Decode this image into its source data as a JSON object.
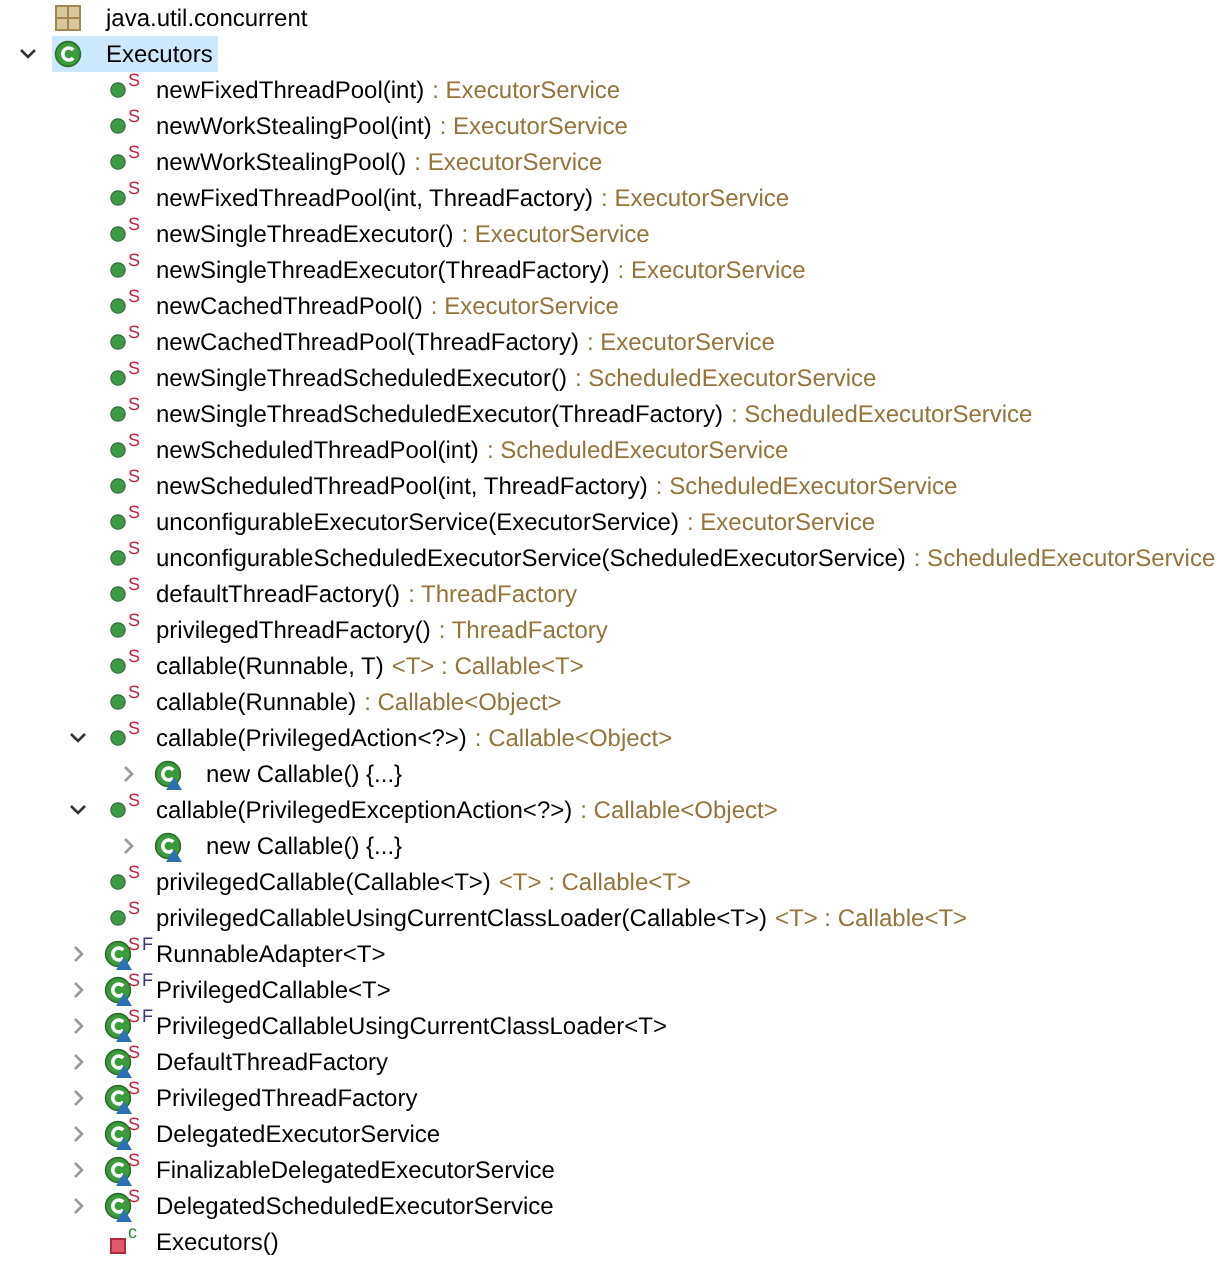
{
  "outline": [
    {
      "kind": "package",
      "name": "java.util.concurrent",
      "selected": false
    },
    {
      "kind": "class",
      "name": "Executors",
      "selected": true,
      "expanded": true,
      "children": [
        {
          "kind": "method",
          "name": "newFixedThreadPool(int)",
          "detail": ": ExecutorService",
          "modifiers": [
            {
              "label": "S",
              "kind": "static"
            }
          ],
          "selected": false
        },
        {
          "kind": "method",
          "name": "newWorkStealingPool(int)",
          "detail": ": ExecutorService",
          "modifiers": [
            {
              "label": "S",
              "kind": "static"
            }
          ],
          "selected": false
        },
        {
          "kind": "method",
          "name": "newWorkStealingPool()",
          "detail": ": ExecutorService",
          "modifiers": [
            {
              "label": "S",
              "kind": "static"
            }
          ],
          "selected": false
        },
        {
          "kind": "method",
          "name": "newFixedThreadPool(int, ThreadFactory)",
          "detail": ": ExecutorService",
          "modifiers": [
            {
              "label": "S",
              "kind": "static"
            }
          ],
          "selected": false
        },
        {
          "kind": "method",
          "name": "newSingleThreadExecutor()",
          "detail": ": ExecutorService",
          "modifiers": [
            {
              "label": "S",
              "kind": "static"
            }
          ],
          "selected": false
        },
        {
          "kind": "method",
          "name": "newSingleThreadExecutor(ThreadFactory)",
          "detail": ": ExecutorService",
          "modifiers": [
            {
              "label": "S",
              "kind": "static"
            }
          ],
          "selected": false
        },
        {
          "kind": "method",
          "name": "newCachedThreadPool()",
          "detail": ": ExecutorService",
          "modifiers": [
            {
              "label": "S",
              "kind": "static"
            }
          ],
          "selected": false
        },
        {
          "kind": "method",
          "name": "newCachedThreadPool(ThreadFactory)",
          "detail": ": ExecutorService",
          "modifiers": [
            {
              "label": "S",
              "kind": "static"
            }
          ],
          "selected": false
        },
        {
          "kind": "method",
          "name": "newSingleThreadScheduledExecutor()",
          "detail": ": ScheduledExecutorService",
          "modifiers": [
            {
              "label": "S",
              "kind": "static"
            }
          ],
          "selected": false
        },
        {
          "kind": "method",
          "name": "newSingleThreadScheduledExecutor(ThreadFactory)",
          "detail": ": ScheduledExecutorService",
          "modifiers": [
            {
              "label": "S",
              "kind": "static"
            }
          ],
          "selected": false
        },
        {
          "kind": "method",
          "name": "newScheduledThreadPool(int)",
          "detail": ": ScheduledExecutorService",
          "modifiers": [
            {
              "label": "S",
              "kind": "static"
            }
          ],
          "selected": false
        },
        {
          "kind": "method",
          "name": "newScheduledThreadPool(int, ThreadFactory)",
          "detail": ": ScheduledExecutorService",
          "modifiers": [
            {
              "label": "S",
              "kind": "static"
            }
          ],
          "selected": false
        },
        {
          "kind": "method",
          "name": "unconfigurableExecutorService(ExecutorService)",
          "detail": ": ExecutorService",
          "modifiers": [
            {
              "label": "S",
              "kind": "static"
            }
          ],
          "selected": false
        },
        {
          "kind": "method",
          "name": "unconfigurableScheduledExecutorService(ScheduledExecutorService)",
          "detail": ": ScheduledExecutorService",
          "modifiers": [
            {
              "label": "S",
              "kind": "static"
            }
          ],
          "selected": false
        },
        {
          "kind": "method",
          "name": "defaultThreadFactory()",
          "detail": ": ThreadFactory",
          "modifiers": [
            {
              "label": "S",
              "kind": "static"
            }
          ],
          "selected": false
        },
        {
          "kind": "method",
          "name": "privilegedThreadFactory()",
          "detail": ": ThreadFactory",
          "modifiers": [
            {
              "label": "S",
              "kind": "static"
            }
          ],
          "selected": false
        },
        {
          "kind": "method",
          "name": "callable(Runnable, T)",
          "detail": "<T> : Callable<T>",
          "modifiers": [
            {
              "label": "S",
              "kind": "static"
            }
          ],
          "selected": false
        },
        {
          "kind": "method",
          "name": "callable(Runnable)",
          "detail": ": Callable<Object>",
          "modifiers": [
            {
              "label": "S",
              "kind": "static"
            }
          ],
          "selected": false
        },
        {
          "kind": "method",
          "name": "callable(PrivilegedAction<?>)",
          "detail": ": Callable<Object>",
          "modifiers": [
            {
              "label": "S",
              "kind": "static"
            }
          ],
          "selected": false,
          "expanded": true,
          "children": [
            {
              "kind": "anonymous",
              "name": "new Callable() {...}",
              "selected": false,
              "expanded": false
            }
          ]
        },
        {
          "kind": "method",
          "name": "callable(PrivilegedExceptionAction<?>)",
          "detail": ": Callable<Object>",
          "modifiers": [
            {
              "label": "S",
              "kind": "static"
            }
          ],
          "selected": false,
          "expanded": true,
          "children": [
            {
              "kind": "anonymous",
              "name": "new Callable() {...}",
              "selected": false,
              "expanded": false
            }
          ]
        },
        {
          "kind": "method",
          "name": "privilegedCallable(Callable<T>)",
          "detail": "<T> : Callable<T>",
          "modifiers": [
            {
              "label": "S",
              "kind": "static"
            }
          ],
          "selected": false
        },
        {
          "kind": "method",
          "name": "privilegedCallableUsingCurrentClassLoader(Callable<T>)",
          "detail": "<T> : Callable<T>",
          "modifiers": [
            {
              "label": "S",
              "kind": "static"
            }
          ],
          "selected": false
        },
        {
          "kind": "inner-class",
          "name": "RunnableAdapter<T>",
          "modifiers": [
            {
              "label": "S",
              "kind": "static"
            },
            {
              "label": "F",
              "kind": "final"
            }
          ],
          "selected": false,
          "expanded": false
        },
        {
          "kind": "inner-class",
          "name": "PrivilegedCallable<T>",
          "modifiers": [
            {
              "label": "S",
              "kind": "static"
            },
            {
              "label": "F",
              "kind": "final"
            }
          ],
          "selected": false,
          "expanded": false
        },
        {
          "kind": "inner-class",
          "name": "PrivilegedCallableUsingCurrentClassLoader<T>",
          "modifiers": [
            {
              "label": "S",
              "kind": "static"
            },
            {
              "label": "F",
              "kind": "final"
            }
          ],
          "selected": false,
          "expanded": false
        },
        {
          "kind": "inner-class",
          "name": "DefaultThreadFactory",
          "modifiers": [
            {
              "label": "S",
              "kind": "static"
            }
          ],
          "selected": false,
          "expanded": false
        },
        {
          "kind": "inner-class",
          "name": "PrivilegedThreadFactory",
          "modifiers": [
            {
              "label": "S",
              "kind": "static"
            }
          ],
          "selected": false,
          "expanded": false
        },
        {
          "kind": "inner-class",
          "name": "DelegatedExecutorService",
          "modifiers": [
            {
              "label": "S",
              "kind": "static"
            }
          ],
          "selected": false,
          "expanded": false
        },
        {
          "kind": "inner-class",
          "name": "FinalizableDelegatedExecutorService",
          "modifiers": [
            {
              "label": "S",
              "kind": "static"
            }
          ],
          "selected": false,
          "expanded": false
        },
        {
          "kind": "inner-class",
          "name": "DelegatedScheduledExecutorService",
          "modifiers": [
            {
              "label": "S",
              "kind": "static"
            }
          ],
          "selected": false,
          "expanded": false
        },
        {
          "kind": "constructor",
          "name": "Executors()",
          "modifiers": [
            {
              "label": "c",
              "kind": "constructor"
            }
          ],
          "selected": false
        }
      ]
    }
  ]
}
